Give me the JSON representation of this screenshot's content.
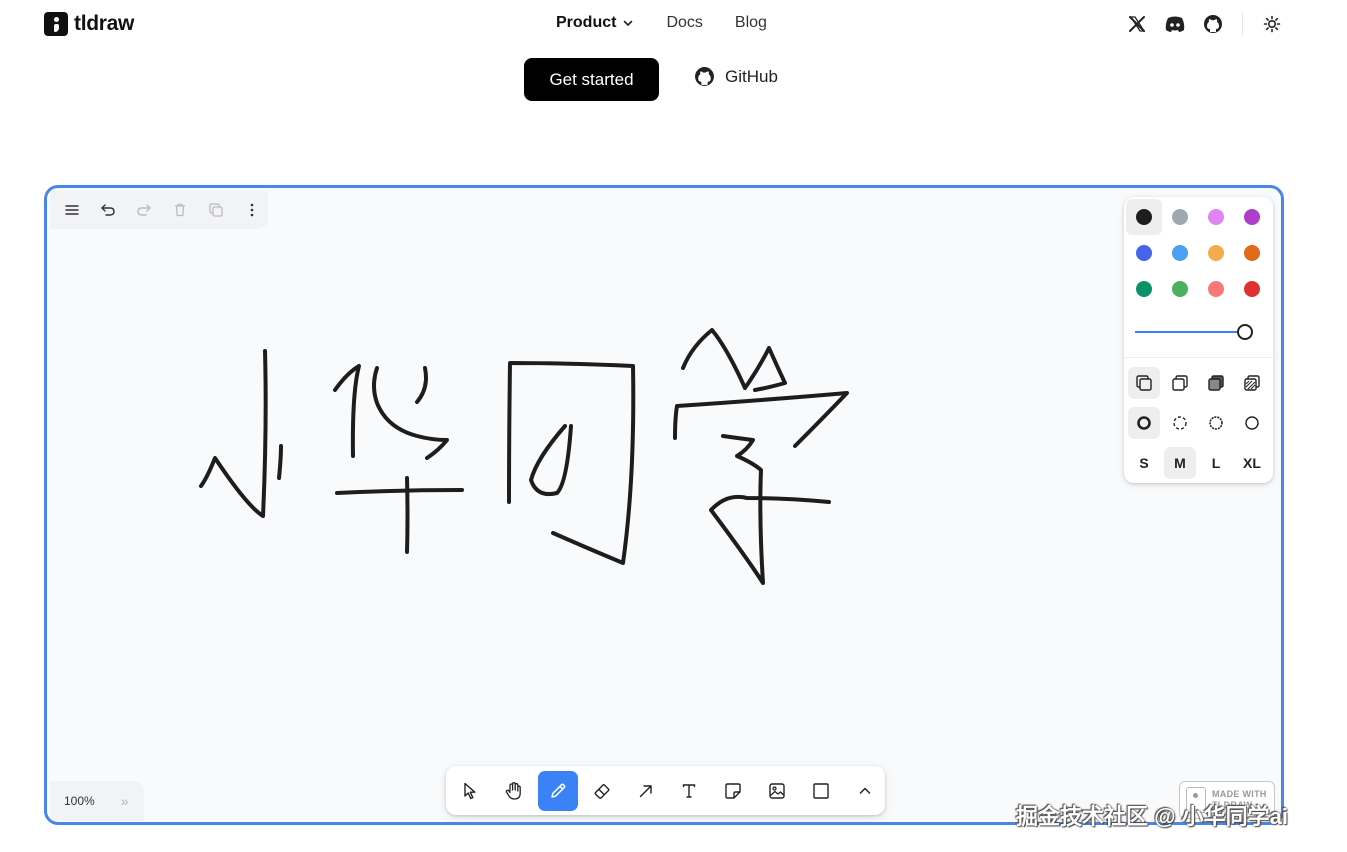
{
  "header": {
    "logo_text": "tldraw",
    "nav": [
      {
        "label": "Product"
      },
      {
        "label": "Docs"
      },
      {
        "label": "Blog"
      }
    ],
    "social_icons": [
      "x-icon",
      "discord-icon",
      "github-icon",
      "theme-toggle-icon"
    ]
  },
  "hero": {
    "cta_label": "Get started",
    "github_label": "GitHub"
  },
  "editor": {
    "menu_icons": [
      "hamburger-menu-icon",
      "undo-icon",
      "redo-icon",
      "trash-icon",
      "duplicate-icon",
      "more-vertical-icon"
    ],
    "colors": [
      {
        "name": "black",
        "hex": "#1d1d1d",
        "selected": true
      },
      {
        "name": "grey",
        "hex": "#9fa8b2"
      },
      {
        "name": "light-violet",
        "hex": "#e085f4"
      },
      {
        "name": "violet",
        "hex": "#ae3ec9"
      },
      {
        "name": "blue",
        "hex": "#4465e9"
      },
      {
        "name": "light-blue",
        "hex": "#4ba1f1"
      },
      {
        "name": "yellow",
        "hex": "#f1ac4b"
      },
      {
        "name": "orange",
        "hex": "#e16919"
      },
      {
        "name": "green",
        "hex": "#099268"
      },
      {
        "name": "light-green",
        "hex": "#4cb05e"
      },
      {
        "name": "light-red",
        "hex": "#f87777"
      },
      {
        "name": "red",
        "hex": "#e03131"
      }
    ],
    "opacity": 1.0,
    "fill_icons": [
      "fill-none-icon",
      "fill-semi-icon",
      "fill-solid-icon",
      "fill-pattern-icon"
    ],
    "dash_icons": [
      "dash-draw-icon",
      "dash-dashed-icon",
      "dash-dotted-icon",
      "dash-solid-icon"
    ],
    "sizes": [
      "S",
      "M",
      "L",
      "XL"
    ],
    "selected_size": "M",
    "tools": [
      "select-icon",
      "hand-icon",
      "draw-icon",
      "eraser-icon",
      "arrow-icon",
      "text-icon",
      "note-icon",
      "image-icon",
      "rectangle-icon",
      "chevron-up-icon"
    ],
    "active_tool": "draw-icon",
    "zoom_label": "100%",
    "zoom_chevron": "»",
    "made_with_line1": "MADE WITH",
    "made_with_line2": "TLDRAW"
  },
  "watermark": "掘金技术社区 @ 小华同学ai"
}
